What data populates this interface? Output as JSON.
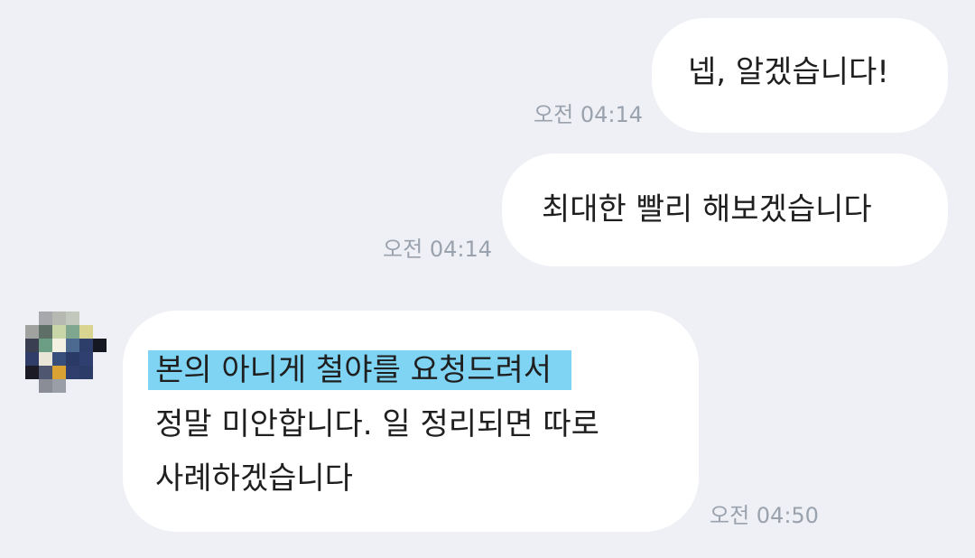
{
  "messages": [
    {
      "direction": "outgoing",
      "text": "넵, 알겠습니다!",
      "time": "오전 04:14"
    },
    {
      "direction": "outgoing",
      "text": "최대한 빨리 해보겠습니다",
      "time": "오전 04:14"
    },
    {
      "direction": "incoming",
      "lines": [
        "본의 아니게 철야를 요청드려서",
        "정말 미안합니다. 일 정리되면 따로",
        "사례하겠습니다"
      ],
      "highlighted_line": "본의 아니게 철야를 요청드려서",
      "time": "오전 04:50"
    }
  ],
  "colors": {
    "background": "#eef0f5",
    "bubble": "#ffffff",
    "highlight": "#7fd4f4",
    "timestamp": "#9aa2ae",
    "text": "#1f1f1f"
  },
  "avatar": {
    "icon": "pixelated-avatar-icon",
    "pixels": [
      "#eef0f5",
      "#a7a8ab",
      "#b5b9b2",
      "#c3c8bc",
      "#eef0f5",
      "#eef0f5",
      "#9fa29e",
      "#5d6f66",
      "#c8d6a8",
      "#7fa78f",
      "#d9d590",
      "#eef0f5",
      "#3a3f52",
      "#6b9e84",
      "#f3f1e2",
      "#4c6a90",
      "#2e3e6a",
      "#161821",
      "#2f3d68",
      "#e9e6d7",
      "#394f7b",
      "#2a3a66",
      "#2e3f70",
      "#eef0f5",
      "#1c1a24",
      "#4f5670",
      "#d9a233",
      "#2f3e6c",
      "#2c3c69",
      "#eef0f5",
      "#eef0f5",
      "#8a8d95",
      "#9a9ea6",
      "#eef0f5",
      "#eef0f5",
      "#eef0f5"
    ]
  }
}
